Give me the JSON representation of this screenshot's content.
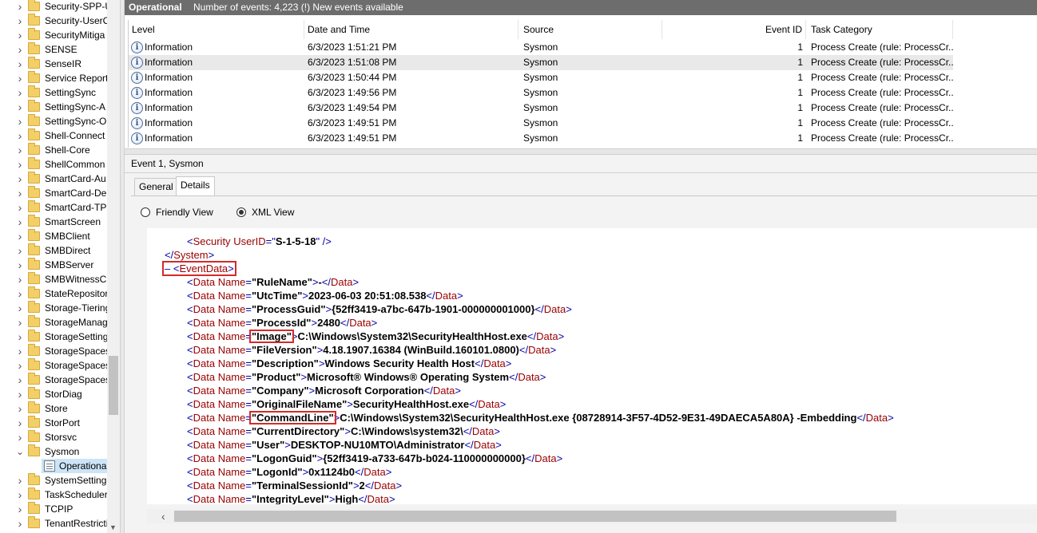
{
  "tree": {
    "items": [
      {
        "label": "Security-SPP-U",
        "expanded": false
      },
      {
        "label": "Security-UserC",
        "expanded": false
      },
      {
        "label": "SecurityMitiga",
        "expanded": false
      },
      {
        "label": "SENSE",
        "expanded": false
      },
      {
        "label": "SenseIR",
        "expanded": false
      },
      {
        "label": "Service Report",
        "expanded": false
      },
      {
        "label": "SettingSync",
        "expanded": false
      },
      {
        "label": "SettingSync-A",
        "expanded": false
      },
      {
        "label": "SettingSync-O",
        "expanded": false
      },
      {
        "label": "Shell-Connect",
        "expanded": false
      },
      {
        "label": "Shell-Core",
        "expanded": false
      },
      {
        "label": "ShellCommon",
        "expanded": false
      },
      {
        "label": "SmartCard-Au",
        "expanded": false
      },
      {
        "label": "SmartCard-De",
        "expanded": false
      },
      {
        "label": "SmartCard-TPI",
        "expanded": false
      },
      {
        "label": "SmartScreen",
        "expanded": false
      },
      {
        "label": "SMBClient",
        "expanded": false
      },
      {
        "label": "SMBDirect",
        "expanded": false
      },
      {
        "label": "SMBServer",
        "expanded": false
      },
      {
        "label": "SMBWitnessCl",
        "expanded": false
      },
      {
        "label": "StateRepositor",
        "expanded": false
      },
      {
        "label": "Storage-Tiering",
        "expanded": false
      },
      {
        "label": "StorageManag",
        "expanded": false
      },
      {
        "label": "StorageSetting",
        "expanded": false
      },
      {
        "label": "StorageSpaces",
        "expanded": false
      },
      {
        "label": "StorageSpaces",
        "expanded": false
      },
      {
        "label": "StorageSpaces",
        "expanded": false
      },
      {
        "label": "StorDiag",
        "expanded": false
      },
      {
        "label": "Store",
        "expanded": false
      },
      {
        "label": "StorPort",
        "expanded": false
      },
      {
        "label": "Storsvc",
        "expanded": false
      },
      {
        "label": "Sysmon",
        "expanded": true
      },
      {
        "label": "Operational",
        "child": true,
        "selected": true
      },
      {
        "label": "SystemSetting",
        "expanded": false
      },
      {
        "label": "TaskScheduler",
        "expanded": false
      },
      {
        "label": "TCPIP",
        "expanded": false
      },
      {
        "label": "TenantRestricti",
        "expanded": false
      }
    ]
  },
  "header": {
    "title": "Operational",
    "info": "Number of events: 4,223 (!) New events available"
  },
  "events": {
    "columns": {
      "level": "Level",
      "datetime": "Date and Time",
      "source": "Source",
      "event_id": "Event ID",
      "task_category": "Task Category"
    },
    "rows": [
      {
        "level": "Information",
        "datetime": "6/3/2023 1:51:21 PM",
        "source": "Sysmon",
        "event_id": "1",
        "task_category": "Process Create (rule: ProcessCr...",
        "selected": false
      },
      {
        "level": "Information",
        "datetime": "6/3/2023 1:51:08 PM",
        "source": "Sysmon",
        "event_id": "1",
        "task_category": "Process Create (rule: ProcessCr...",
        "selected": true
      },
      {
        "level": "Information",
        "datetime": "6/3/2023 1:50:44 PM",
        "source": "Sysmon",
        "event_id": "1",
        "task_category": "Process Create (rule: ProcessCr...",
        "selected": false
      },
      {
        "level": "Information",
        "datetime": "6/3/2023 1:49:56 PM",
        "source": "Sysmon",
        "event_id": "1",
        "task_category": "Process Create (rule: ProcessCr...",
        "selected": false
      },
      {
        "level": "Information",
        "datetime": "6/3/2023 1:49:54 PM",
        "source": "Sysmon",
        "event_id": "1",
        "task_category": "Process Create (rule: ProcessCr...",
        "selected": false
      },
      {
        "level": "Information",
        "datetime": "6/3/2023 1:49:51 PM",
        "source": "Sysmon",
        "event_id": "1",
        "task_category": "Process Create (rule: ProcessCr...",
        "selected": false
      },
      {
        "level": "Information",
        "datetime": "6/3/2023 1:49:51 PM",
        "source": "Sysmon",
        "event_id": "1",
        "task_category": "Process Create (rule: ProcessCr...",
        "selected": false
      }
    ]
  },
  "details": {
    "title": "Event 1, Sysmon",
    "tabs": {
      "general": "General",
      "details": "Details"
    },
    "view_options": {
      "friendly": "Friendly View",
      "xml": "XML View",
      "selected": "xml"
    },
    "xml": {
      "security_tag": "Security",
      "security_attr_name": "UserID",
      "security_attr_value": "S-1-5-18",
      "system_close": "System",
      "collapse_glyph": "–",
      "eventdata_tag": "EventData",
      "data_tag": "Data",
      "name_attr": "Name",
      "data_items": [
        {
          "name": "RuleName",
          "value": "-"
        },
        {
          "name": "UtcTime",
          "value": "2023-06-03 20:51:08.538"
        },
        {
          "name": "ProcessGuid",
          "value": "{52ff3419-a7bc-647b-1901-000000001000}"
        },
        {
          "name": "ProcessId",
          "value": "2480"
        },
        {
          "name": "Image",
          "value": "C:\\Windows\\System32\\SecurityHealthHost.exe"
        },
        {
          "name": "FileVersion",
          "value": "4.18.1907.16384 (WinBuild.160101.0800)"
        },
        {
          "name": "Description",
          "value": "Windows Security Health Host"
        },
        {
          "name": "Product",
          "value": "Microsoft® Windows® Operating System"
        },
        {
          "name": "Company",
          "value": "Microsoft Corporation"
        },
        {
          "name": "OriginalFileName",
          "value": "SecurityHealthHost.exe"
        },
        {
          "name": "CommandLine",
          "value": "C:\\Windows\\System32\\SecurityHealthHost.exe {08728914-3F57-4D52-9E31-49DAECA5A80A} -Embedding"
        },
        {
          "name": "CurrentDirectory",
          "value": "C:\\Windows\\system32\\"
        },
        {
          "name": "User",
          "value": "DESKTOP-NU10MTO\\Administrator"
        },
        {
          "name": "LogonGuid",
          "value": "{52ff3419-a733-647b-b024-110000000000}"
        },
        {
          "name": "LogonId",
          "value": "0x1124b0"
        },
        {
          "name": "TerminalSessionId",
          "value": "2"
        },
        {
          "name": "IntegrityLevel",
          "value": "High"
        }
      ],
      "highlighted": [
        "EventData",
        "Image",
        "CommandLine"
      ]
    }
  },
  "colors": {
    "header_bg": "#6d6d6d",
    "xml_tag": "#990000",
    "xml_bracket": "#0000aa",
    "highlight_box": "#d42a2a",
    "selection": "#cce4f7"
  }
}
